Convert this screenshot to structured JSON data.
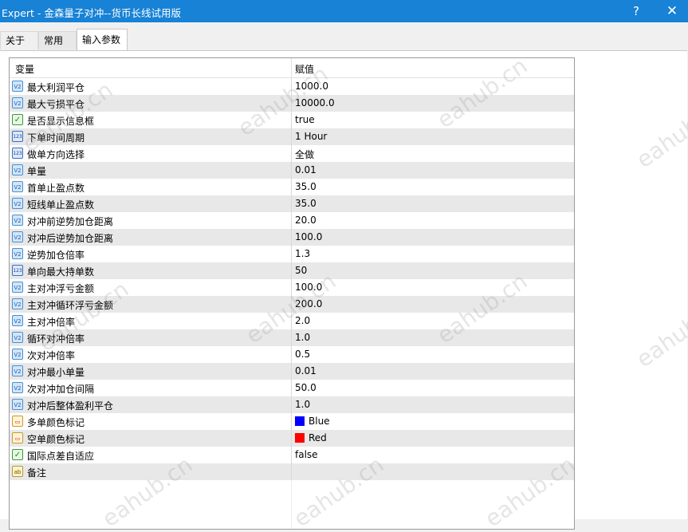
{
  "window": {
    "title": "Expert - 金森量子对冲--货币长线试用版",
    "help_label": "?",
    "close_label": "✕"
  },
  "tabs": [
    {
      "label": "关于"
    },
    {
      "label": "常用"
    },
    {
      "label": "输入参数"
    }
  ],
  "grid": {
    "headers": {
      "variable": "变量",
      "value": "赋值"
    },
    "rows": [
      {
        "type": "num",
        "icon": "V2",
        "name": "最大利润平仓",
        "value": "1000.0"
      },
      {
        "type": "num",
        "icon": "V2",
        "name": "最大亏损平仓",
        "value": "10000.0"
      },
      {
        "type": "bool",
        "icon": "✓",
        "name": "是否显示信息框",
        "value": "true"
      },
      {
        "type": "int",
        "icon": "123",
        "name": "下单时间周期",
        "value": "1 Hour"
      },
      {
        "type": "int",
        "icon": "123",
        "name": "做单方向选择",
        "value": "全做"
      },
      {
        "type": "num",
        "icon": "V2",
        "name": "单量",
        "value": "0.01"
      },
      {
        "type": "num",
        "icon": "V2",
        "name": "首单止盈点数",
        "value": "35.0"
      },
      {
        "type": "num",
        "icon": "V2",
        "name": "短线单止盈点数",
        "value": "35.0"
      },
      {
        "type": "num",
        "icon": "V2",
        "name": "对冲前逆势加仓距离",
        "value": "20.0"
      },
      {
        "type": "num",
        "icon": "V2",
        "name": "对冲后逆势加仓距离",
        "value": "100.0"
      },
      {
        "type": "num",
        "icon": "V2",
        "name": "逆势加仓倍率",
        "value": "1.3"
      },
      {
        "type": "int",
        "icon": "123",
        "name": "单向最大持单数",
        "value": "50"
      },
      {
        "type": "num",
        "icon": "V2",
        "name": "主对冲浮亏金额",
        "value": "100.0"
      },
      {
        "type": "num",
        "icon": "V2",
        "name": "主对冲循环浮亏金额",
        "value": "200.0"
      },
      {
        "type": "num",
        "icon": "V2",
        "name": "主对冲倍率",
        "value": "2.0"
      },
      {
        "type": "num",
        "icon": "V2",
        "name": "循环对冲倍率",
        "value": "1.0"
      },
      {
        "type": "num",
        "icon": "V2",
        "name": "次对冲倍率",
        "value": "0.5"
      },
      {
        "type": "num",
        "icon": "V2",
        "name": "对冲最小单量",
        "value": "0.01"
      },
      {
        "type": "num",
        "icon": "V2",
        "name": "次对冲加仓间隔",
        "value": "50.0"
      },
      {
        "type": "num",
        "icon": "V2",
        "name": "对冲后整体盈利平仓",
        "value": "1.0"
      },
      {
        "type": "color",
        "icon": "▭",
        "name": "多单颜色标记",
        "value": "Blue",
        "swatch": "#0000ff"
      },
      {
        "type": "color",
        "icon": "▭",
        "name": "空单颜色标记",
        "value": "Red",
        "swatch": "#ff0000"
      },
      {
        "type": "bool",
        "icon": "✓",
        "name": "国际点差自适应",
        "value": "false"
      },
      {
        "type": "str",
        "icon": "ab",
        "name": "备注",
        "value": ""
      }
    ]
  },
  "watermark": "eahub.cn",
  "colors": {
    "titlebar": "#1782d6",
    "row_alt": "#e8e8e8"
  }
}
